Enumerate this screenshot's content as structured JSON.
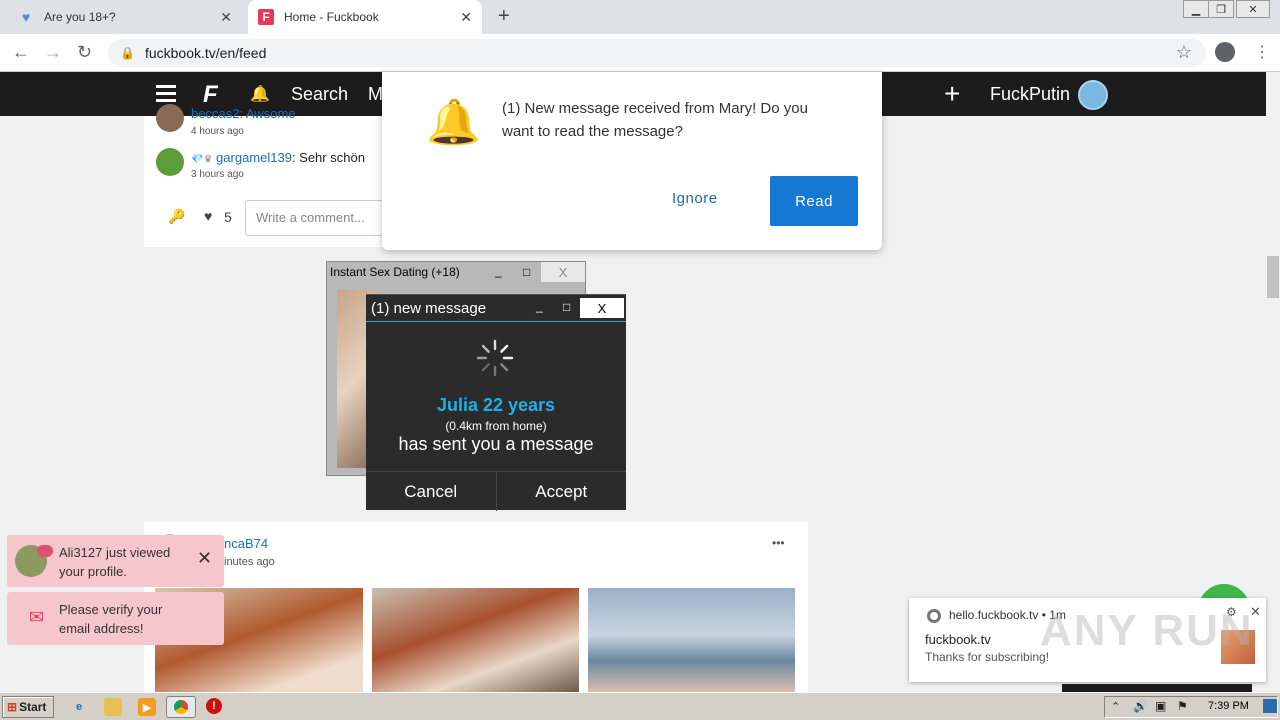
{
  "browser": {
    "tabs": [
      {
        "title": "Are you 18+?",
        "icon": "heart-icon"
      },
      {
        "title": "Home - Fuckbook",
        "icon": "fuckbook-favicon",
        "active": true
      }
    ],
    "new_tab": "+",
    "url": "fuckbook.tv/en/feed",
    "window_controls": [
      "minimize",
      "restore",
      "close"
    ]
  },
  "site_header": {
    "logo": "F",
    "search_label": "Search",
    "m_label": "M",
    "plus": "+",
    "username": "FuckPutin"
  },
  "feed": {
    "comment_partial_text": "beccas2: Awsome",
    "comment_partial_time": "4 hours ago",
    "comment_user": "gargamel139",
    "comment_text": ": Sehr schön",
    "comment_time": "3 hours ago",
    "likes": "5",
    "write_comment_placeholder": "Write a comment...",
    "post_user": "BiancaB74",
    "post_user_visible": "ncaB74",
    "post_time_visible": "inutes ago",
    "more_dots": "•••"
  },
  "notification_dialog": {
    "text": "(1) New message received from Mary! Do you want to read the message?",
    "ignore_label": "Ignore",
    "read_label": "Read"
  },
  "popup_back": {
    "title": "Instant Sex Dating (+18)",
    "min": "_",
    "max": "□",
    "close": "X"
  },
  "popup_front": {
    "title": "(1) new message",
    "min": "_",
    "max": "□",
    "close": "X",
    "name": "Julia 22 years",
    "distance": "(0.4km from home)",
    "message": "has sent you a message",
    "cancel_label": "Cancel",
    "accept_label": "Accept"
  },
  "toasts": [
    {
      "text": "Ali3127 just viewed your profile.",
      "icon": "user-avatar-icon",
      "close": "✕"
    },
    {
      "text": "Please verify your email address!",
      "icon": "envelope-icon"
    }
  ],
  "chrome_notification": {
    "source": "hello.fuckbook.tv",
    "age": "1m",
    "title": "fuckbook.tv",
    "message": "Thanks for subscribing!"
  },
  "watermark": "ANY RUN",
  "taskbar": {
    "start_label": "Start",
    "clock": "7:39 PM"
  },
  "colors": {
    "accent_blue": "#1478d4",
    "header_bg": "#1c1c1c",
    "toast_pink": "#f6c6cd",
    "julia_blue": "#1ab0e8"
  }
}
